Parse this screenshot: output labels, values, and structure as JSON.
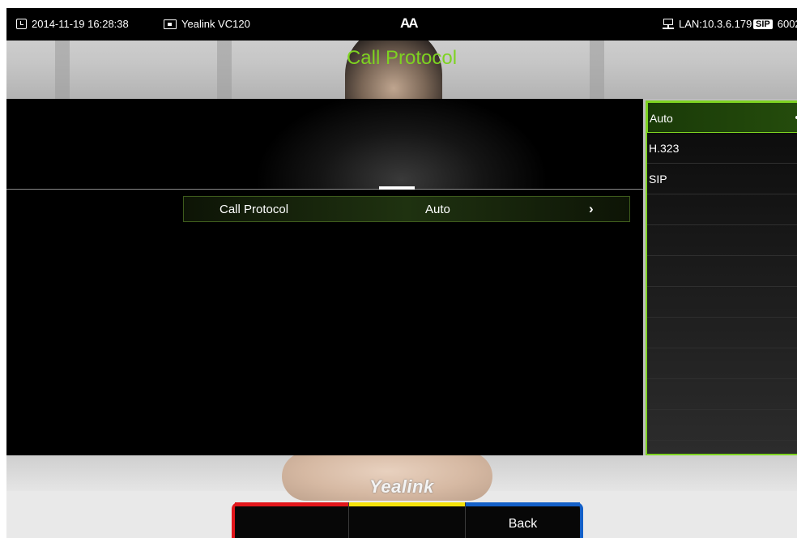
{
  "status_bar": {
    "datetime": "2014-11-19 16:28:38",
    "device_name": "Yealink VC120",
    "font_icon": "AA",
    "lan": "LAN:10.3.6.179",
    "sip_badge": "SIP",
    "sip_account": "6002"
  },
  "page": {
    "title": "Call Protocol"
  },
  "setting": {
    "label": "Call Protocol",
    "value": "Auto",
    "chevron": "›"
  },
  "options": {
    "items": [
      "Auto",
      "H.323",
      "SIP"
    ],
    "selected": "Auto"
  },
  "brand": {
    "logo_text": "Yealink"
  },
  "softkeys": {
    "red": "",
    "yellow": "",
    "blue": "Back"
  },
  "colors": {
    "accent_green": "#7ed321",
    "softkey_red": "#e2161b",
    "softkey_yellow": "#f5e20a",
    "softkey_blue": "#1460c8"
  }
}
